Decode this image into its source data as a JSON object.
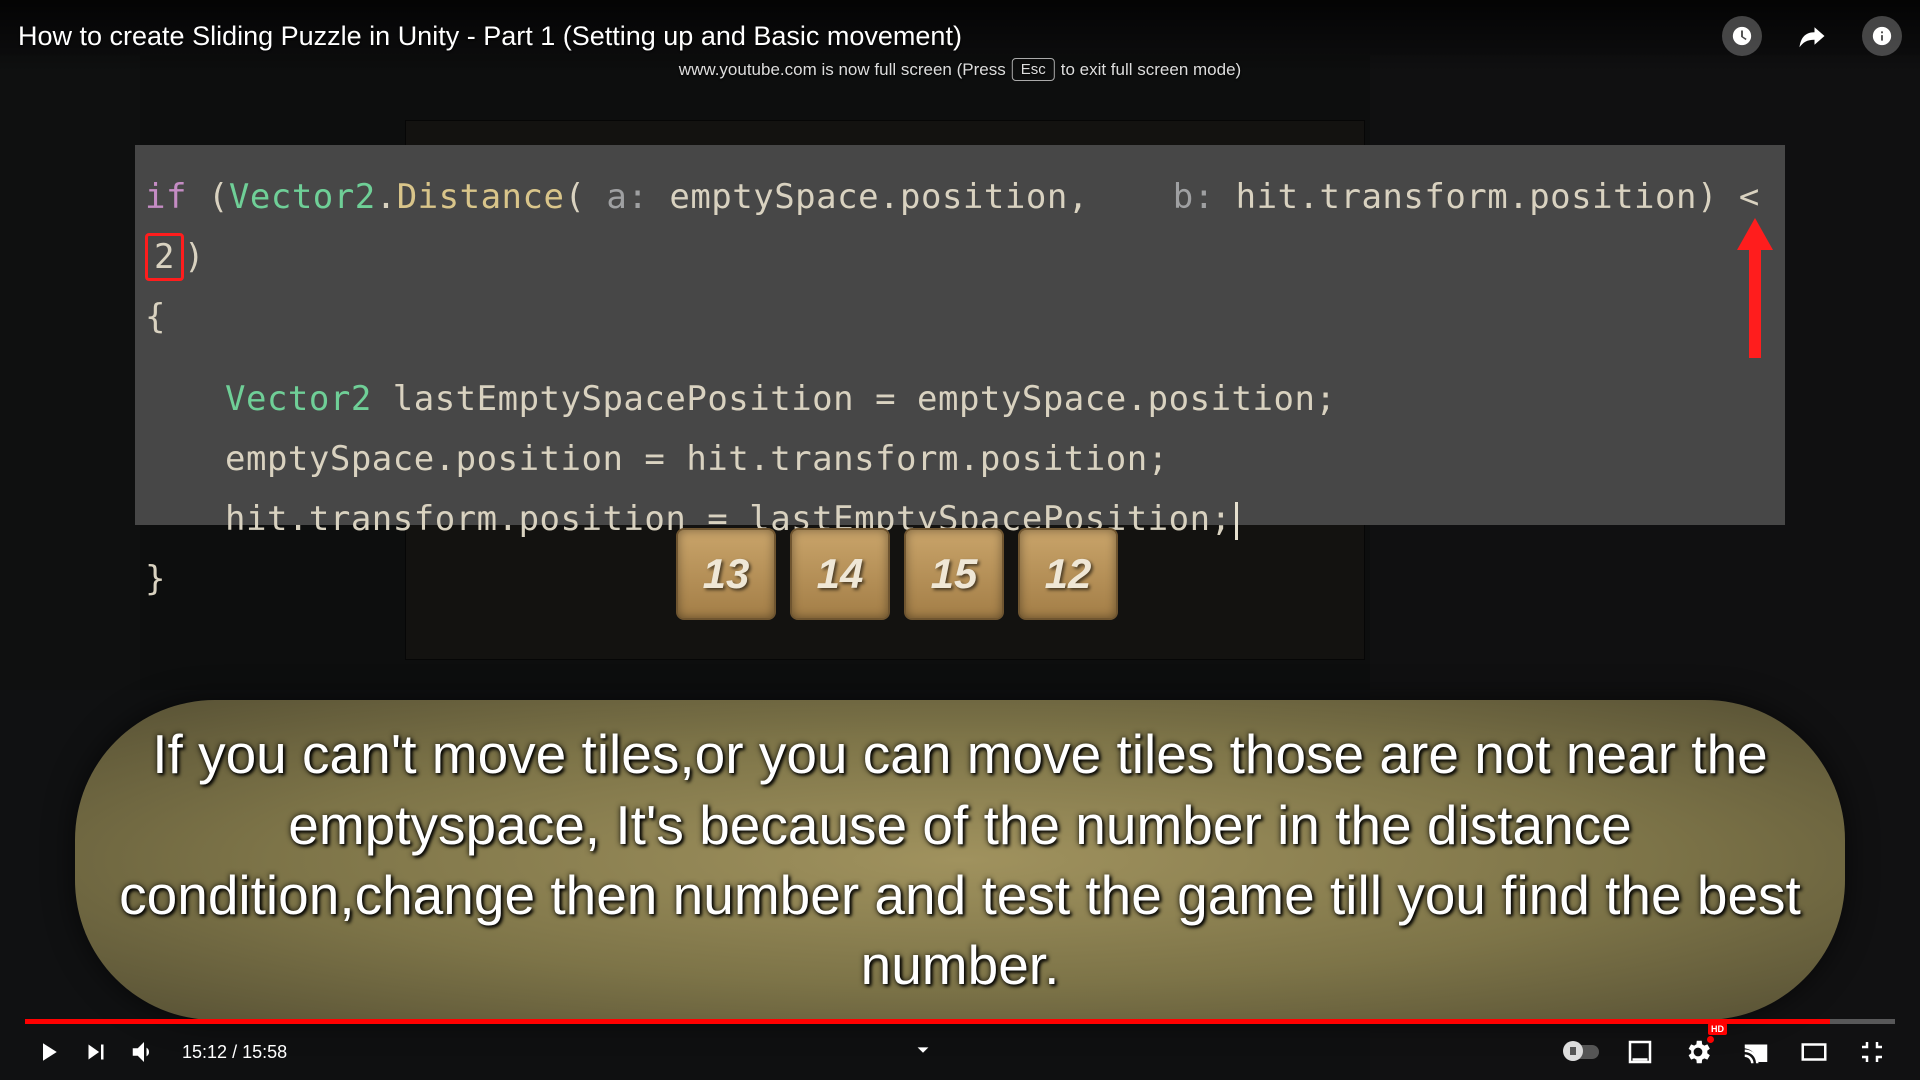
{
  "video": {
    "title": "How to create Sliding Puzzle in Unity - Part 1 (Setting up and Basic movement)",
    "current_time": "15:12",
    "duration": "15:58"
  },
  "fullscreen_notice": {
    "prefix": "www.youtube.com is now full screen (Press",
    "key": "Esc",
    "suffix": "to exit full screen mode)"
  },
  "code": {
    "if": "if",
    "type1": "Vector2",
    "method": "Distance",
    "param_a": "a:",
    "arg_a": "emptySpace.position,",
    "param_b": "b:",
    "arg_b": "hit.transform.position)",
    "lt": "<",
    "threshold": "2",
    "brace_open": "{",
    "line2_type": "Vector2",
    "line2_rest": " lastEmptySpacePosition = emptySpace.position;",
    "line3": "emptySpace.position = hit.transform.position;",
    "line4": "hit.transform.position = lastEmptySpacePosition;",
    "brace_close": "}"
  },
  "tiles": [
    "13",
    "14",
    "15",
    "12"
  ],
  "subtitle": "If you can't move tiles,or you can move tiles those are not near the emptyspace, It's because of the number in the distance condition,change then number and test the game till you find the best number.",
  "settings_badge": "HD"
}
